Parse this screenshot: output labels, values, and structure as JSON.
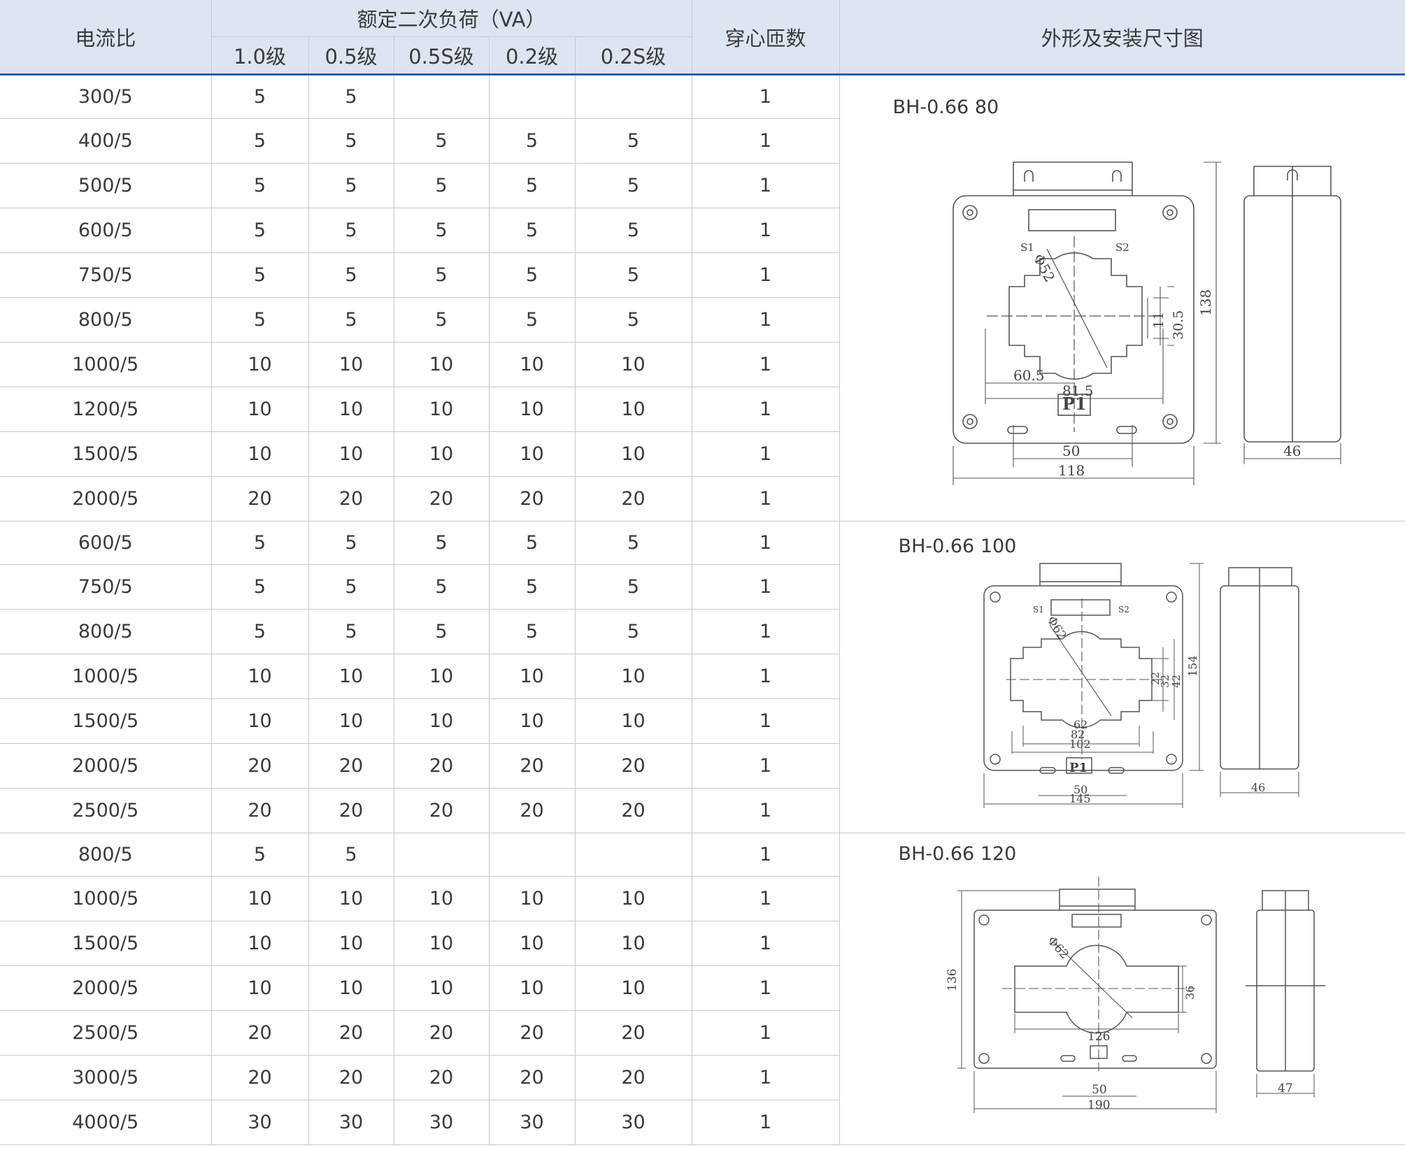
{
  "header": {
    "ratio": "电流比",
    "burden_group": "额定二次负荷（VA）",
    "classes": [
      "1.0级",
      "0.5级",
      "0.5S级",
      "0.2级",
      "0.2S级"
    ],
    "turns": "穿心匝数",
    "drawing": "外形及安装尺寸图"
  },
  "groups": [
    {
      "model": "BH-0.66 80",
      "rows": [
        {
          "ratio": "300/5",
          "v": [
            "5",
            "5",
            "",
            "",
            ""
          ],
          "turns": "1"
        },
        {
          "ratio": "400/5",
          "v": [
            "5",
            "5",
            "5",
            "5",
            "5"
          ],
          "turns": "1"
        },
        {
          "ratio": "500/5",
          "v": [
            "5",
            "5",
            "5",
            "5",
            "5"
          ],
          "turns": "1"
        },
        {
          "ratio": "600/5",
          "v": [
            "5",
            "5",
            "5",
            "5",
            "5"
          ],
          "turns": "1"
        },
        {
          "ratio": "750/5",
          "v": [
            "5",
            "5",
            "5",
            "5",
            "5"
          ],
          "turns": "1"
        },
        {
          "ratio": "800/5",
          "v": [
            "5",
            "5",
            "5",
            "5",
            "5"
          ],
          "turns": "1"
        },
        {
          "ratio": "1000/5",
          "v": [
            "10",
            "10",
            "10",
            "10",
            "10"
          ],
          "turns": "1"
        },
        {
          "ratio": "1200/5",
          "v": [
            "10",
            "10",
            "10",
            "10",
            "10"
          ],
          "turns": "1"
        },
        {
          "ratio": "1500/5",
          "v": [
            "10",
            "10",
            "10",
            "10",
            "10"
          ],
          "turns": "1"
        },
        {
          "ratio": "2000/5",
          "v": [
            "20",
            "20",
            "20",
            "20",
            "20"
          ],
          "turns": "1"
        }
      ],
      "dims": {
        "hole": "Φ52",
        "w1": "60.5",
        "w2": "81.5",
        "h1": "11",
        "h2": "30.5",
        "height": "138",
        "mount": "50",
        "width": "118",
        "depth": "46",
        "s1": "S1",
        "s2": "S2",
        "p1": "P1"
      }
    },
    {
      "model": "BH-0.66 100",
      "rows": [
        {
          "ratio": "600/5",
          "v": [
            "5",
            "5",
            "5",
            "5",
            "5"
          ],
          "turns": "1"
        },
        {
          "ratio": "750/5",
          "v": [
            "5",
            "5",
            "5",
            "5",
            "5"
          ],
          "turns": "1"
        },
        {
          "ratio": "800/5",
          "v": [
            "5",
            "5",
            "5",
            "5",
            "5"
          ],
          "turns": "1"
        },
        {
          "ratio": "1000/5",
          "v": [
            "10",
            "10",
            "10",
            "10",
            "10"
          ],
          "turns": "1"
        },
        {
          "ratio": "1500/5",
          "v": [
            "10",
            "10",
            "10",
            "10",
            "10"
          ],
          "turns": "1"
        },
        {
          "ratio": "2000/5",
          "v": [
            "20",
            "20",
            "20",
            "20",
            "20"
          ],
          "turns": "1"
        },
        {
          "ratio": "2500/5",
          "v": [
            "20",
            "20",
            "20",
            "20",
            "20"
          ],
          "turns": "1"
        }
      ],
      "dims": {
        "hole": "Φ62",
        "w1": "62",
        "w2": "82",
        "w3": "102",
        "h1": "22",
        "h2": "32",
        "h3": "42",
        "height": "154",
        "mount": "50",
        "width": "145",
        "depth": "46",
        "s1": "S1",
        "s2": "S2",
        "p1": "P1"
      }
    },
    {
      "model": "BH-0.66 120",
      "rows": [
        {
          "ratio": "800/5",
          "v": [
            "5",
            "5",
            "",
            "",
            ""
          ],
          "turns": "1"
        },
        {
          "ratio": "1000/5",
          "v": [
            "10",
            "10",
            "10",
            "10",
            "10"
          ],
          "turns": "1"
        },
        {
          "ratio": "1500/5",
          "v": [
            "10",
            "10",
            "10",
            "10",
            "10"
          ],
          "turns": "1"
        },
        {
          "ratio": "2000/5",
          "v": [
            "10",
            "10",
            "10",
            "10",
            "10"
          ],
          "turns": "1"
        },
        {
          "ratio": "2500/5",
          "v": [
            "20",
            "20",
            "20",
            "20",
            "20"
          ],
          "turns": "1"
        },
        {
          "ratio": "3000/5",
          "v": [
            "20",
            "20",
            "20",
            "20",
            "20"
          ],
          "turns": "1"
        },
        {
          "ratio": "4000/5",
          "v": [
            "30",
            "30",
            "30",
            "30",
            "30"
          ],
          "turns": "1"
        }
      ],
      "dims": {
        "hole": "Φ62",
        "w1": "126",
        "h1": "36",
        "height": "136",
        "mount": "50",
        "width": "190",
        "depth": "47"
      }
    }
  ]
}
